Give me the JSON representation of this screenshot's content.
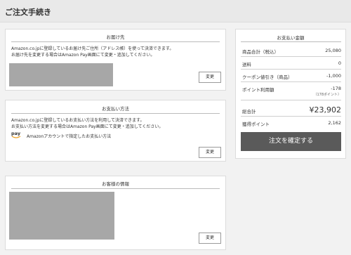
{
  "page": {
    "title": "ご注文手続き"
  },
  "shipping": {
    "title": "お届け先",
    "note_line1": "Amazon.co.jpに登録しているお届け先ご住所（アドレス帳）を使って決済できます。",
    "note_line2": "お届け先を変更する場合はAmazon Pay画面にて変更・追加してください。",
    "change_label": "変更"
  },
  "payment": {
    "title": "お支払い方法",
    "note_line1": "Amazon.co.jpに登録しているお支払い方法を利用して決済できます。",
    "note_line2": "お支払い方法を変更する場合はAmazon Pay画面にて変更・追加してください。",
    "pay_logo_text": "pay",
    "pay_label": "Amazonアカウントで指定したお支払い方法",
    "change_label": "変更"
  },
  "customer": {
    "title": "お客様の情報",
    "change_label": "変更"
  },
  "summary": {
    "title": "お支払い金額",
    "subtotal_label": "商品合計（税込）",
    "subtotal_value": "25,080",
    "shipping_label": "送料",
    "shipping_value": "0",
    "coupon_label": "クーポン値引き（商品）",
    "coupon_value": "-1,000",
    "points_label": "ポイント利用額",
    "points_value": "-178",
    "points_sub": "（178ポイント）",
    "total_label": "総合計",
    "total_value": "¥23,902",
    "earn_label": "獲得ポイント",
    "earn_value": "2,162",
    "confirm_label": "注文を確定する"
  }
}
